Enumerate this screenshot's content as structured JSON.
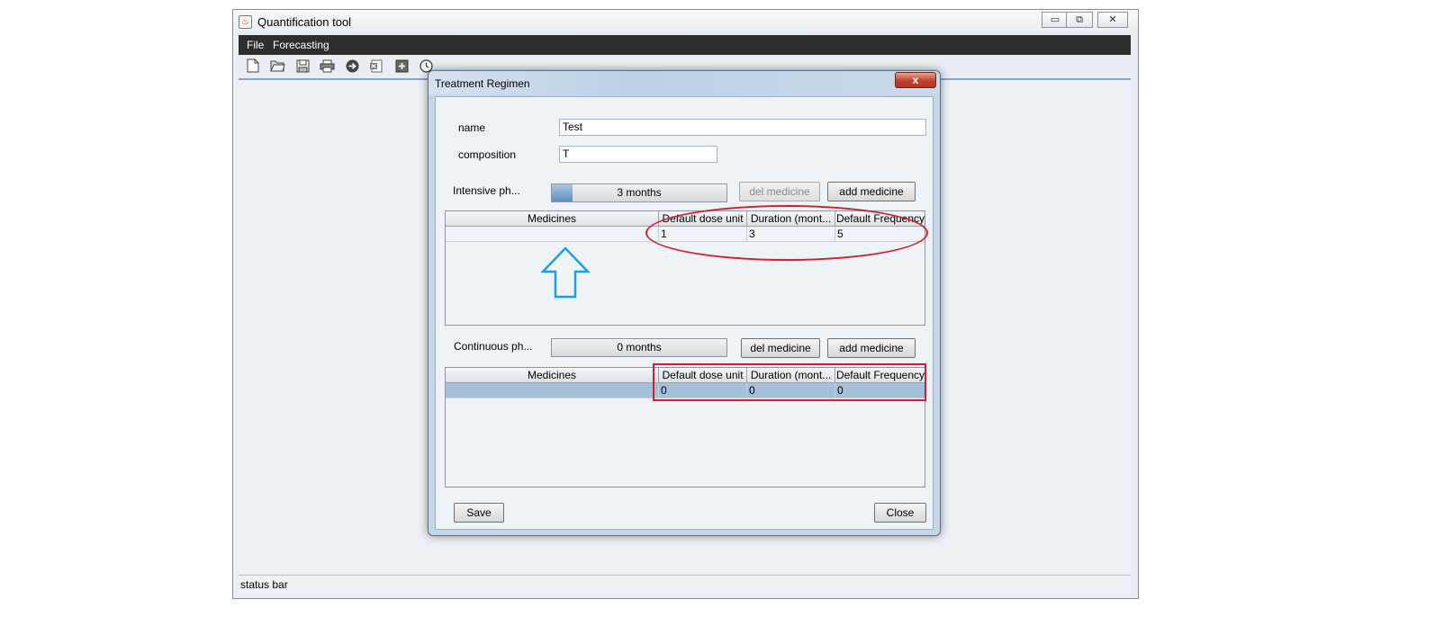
{
  "window": {
    "title": "Quantification tool",
    "controls": {
      "minimize": "▭",
      "maximize": "⧉",
      "close": "✕"
    }
  },
  "menu": [
    "File",
    "Forecasting"
  ],
  "toolbar": [
    "new-file-icon",
    "open-folder-icon",
    "save-icon",
    "print-icon",
    "next-arrow-icon",
    "excel-icon",
    "add-icon",
    "clock-icon"
  ],
  "status_bar": {
    "text": "status bar"
  },
  "dialog": {
    "title": "Treatment Regimen",
    "close_label": "x",
    "name": {
      "label": "name",
      "value": "Test"
    },
    "composition": {
      "label": "composition",
      "value": "T"
    },
    "intensive": {
      "label": "Intensive ph...",
      "duration_text": "3 months",
      "fill_fraction": 0.12,
      "del_label": "del medicine",
      "add_label": "add medicine",
      "columns": [
        "Medicines",
        "Default dose unit",
        "Duration (mont...",
        "Default Frequency"
      ],
      "rows": [
        [
          "",
          "1",
          "3",
          "5"
        ]
      ]
    },
    "continuous": {
      "label": "Continuous ph...",
      "duration_text": "0 months",
      "fill_fraction": 0,
      "del_label": "del medicine",
      "add_label": "add medicine",
      "columns": [
        "Medicines",
        "Default dose unit",
        "Duration (mont...",
        "Default Frequency"
      ],
      "rows": [
        [
          "",
          "0",
          "0",
          "0"
        ]
      ]
    },
    "save_label": "Save",
    "close_button_label": "Close"
  },
  "colors": {
    "annotation_red": "#d02030",
    "annotation_arrow_blue": "#1aa0e6",
    "menubar": "#2e2e2e"
  }
}
